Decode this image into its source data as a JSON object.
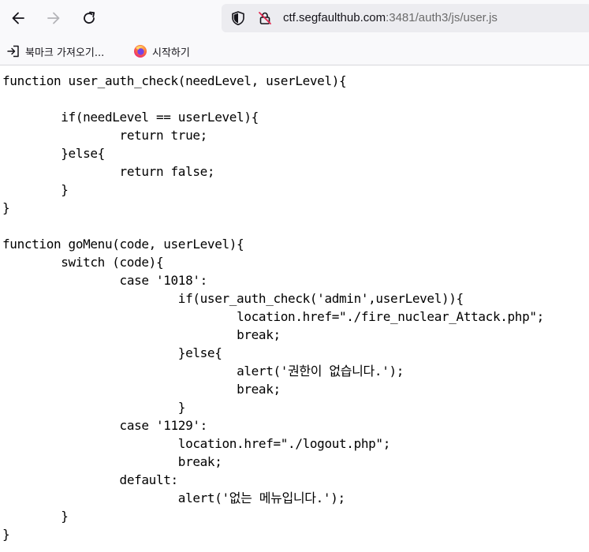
{
  "browser": {
    "url_host": "ctf.segfaulthub.com",
    "url_rest": ":3481/auth3/js/user.js"
  },
  "bookmarks": {
    "import_label": "북마크 가져오기...",
    "start_label": "시작하기"
  },
  "file": {
    "content": "function user_auth_check(needLevel, userLevel){\n\n\tif(needLevel == userLevel){\n\t\treturn true;\n\t}else{\n\t\treturn false;\n\t}\n}\n\nfunction goMenu(code, userLevel){\n\tswitch (code){\n\t\tcase '1018':\n\t\t\tif(user_auth_check('admin',userLevel)){\n\t\t\t\tlocation.href=\"./fire_nuclear_Attack.php\";\n\t\t\t\tbreak;\n\t\t\t}else{\n\t\t\t\talert('권한이 없습니다.');\n\t\t\t\tbreak;\n\t\t\t}\n\t\tcase '1129':\n\t\t\tlocation.href=\"./logout.php\";\n\t\t\tbreak;\n\t\tdefault:\n\t\t\talert('없는 메뉴입니다.');\n\t}\n}"
  }
}
